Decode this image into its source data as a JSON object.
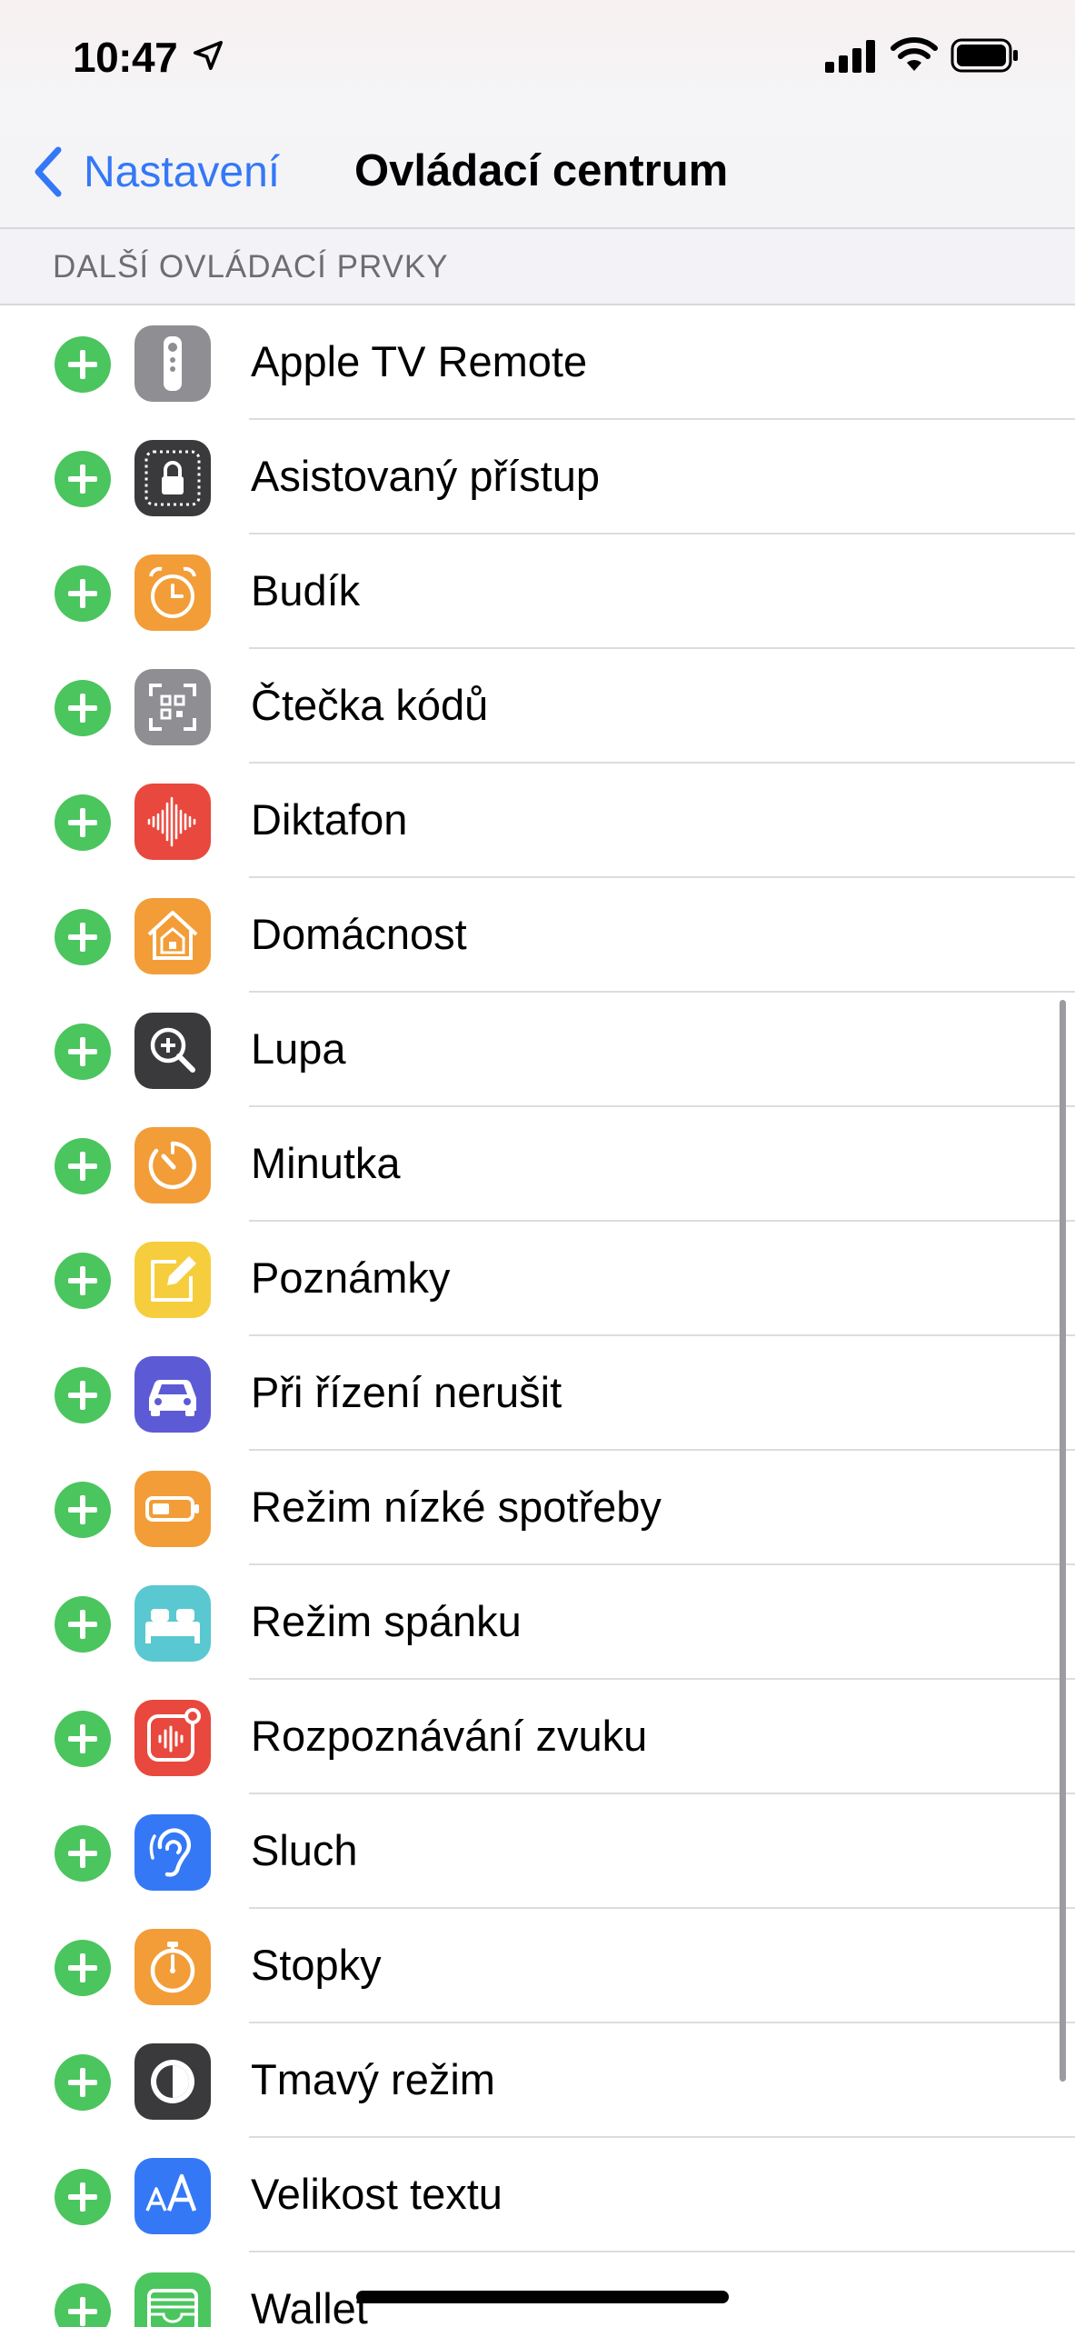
{
  "status_bar": {
    "time": "10:47",
    "icons": [
      "location-arrow-icon",
      "cellular-signal-icon",
      "wifi-icon",
      "battery-icon"
    ]
  },
  "nav": {
    "back_label": "Nastavení",
    "title": "Ovládací centrum"
  },
  "section": {
    "header": "DALŠÍ OVLÁDACÍ PRVKY"
  },
  "colors": {
    "accent": "#3478f6",
    "add_button": "#4bc55e"
  },
  "controls": [
    {
      "label": "Apple TV Remote",
      "icon": "apple-tv-remote-icon",
      "color": "#8e8e93"
    },
    {
      "label": "Asistovaný přístup",
      "icon": "guided-access-icon",
      "color": "#3a3a3c"
    },
    {
      "label": "Budík",
      "icon": "alarm-icon",
      "color": "#f29d38"
    },
    {
      "label": "Čtečka kódů",
      "icon": "code-scanner-icon",
      "color": "#8e8e93"
    },
    {
      "label": "Diktafon",
      "icon": "voice-memos-icon",
      "color": "#e8483d"
    },
    {
      "label": "Domácnost",
      "icon": "home-icon",
      "color": "#f29d38"
    },
    {
      "label": "Lupa",
      "icon": "magnifier-icon",
      "color": "#3a3a3c"
    },
    {
      "label": "Minutka",
      "icon": "timer-icon",
      "color": "#f29d38"
    },
    {
      "label": "Poznámky",
      "icon": "notes-icon",
      "color": "#f6cd3c"
    },
    {
      "label": "Při řízení nerušit",
      "icon": "car-icon",
      "color": "#5d5ad6"
    },
    {
      "label": "Režim nízké spotřeby",
      "icon": "low-power-battery-icon",
      "color": "#f29d38"
    },
    {
      "label": "Režim spánku",
      "icon": "bed-icon",
      "color": "#5ac8d0"
    },
    {
      "label": "Rozpoznávání zvuku",
      "icon": "sound-recognition-icon",
      "color": "#e8483d"
    },
    {
      "label": "Sluch",
      "icon": "ear-icon",
      "color": "#3478f6"
    },
    {
      "label": "Stopky",
      "icon": "stopwatch-icon",
      "color": "#f29d38"
    },
    {
      "label": "Tmavý režim",
      "icon": "dark-mode-icon",
      "color": "#3a3a3c"
    },
    {
      "label": "Velikost textu",
      "icon": "text-size-icon",
      "color": "#3478f6"
    },
    {
      "label": "Wallet",
      "icon": "wallet-icon",
      "color": "#4bc55e"
    }
  ]
}
